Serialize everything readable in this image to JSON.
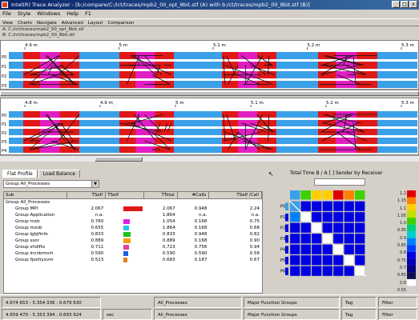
{
  "window": {
    "title": "Intel(R) Trace Analyzer - [b:/compare/C:/ict/traces/mpb2_00_opt_8bit.stf (A) with b:/ct/traces/mpb2_00_8bit.stf (B)]",
    "min": "_",
    "max": "□",
    "close": "x"
  },
  "menu": [
    "File",
    "Style",
    "Windows",
    "Help",
    "F1"
  ],
  "toolbar": [
    "View",
    "Charts",
    "Navigate",
    "Advanced",
    "Layout",
    "Comparison"
  ],
  "files": {
    "a": "A: C:/ict/traces/mpb2_00_opt_8bit.stf",
    "b": "B: C:/ict/traces/mpb2_00_8bit.stf"
  },
  "timeline_top": {
    "ticks": [
      "4.9 m",
      "5 m",
      "5.1 m",
      "5.2 m",
      "5.3 m"
    ],
    "processes": [
      "P0",
      "P1",
      "P2",
      "P3"
    ]
  },
  "timeline_bottom": {
    "ticks": [
      "4.8 m",
      "4.9 m",
      "5 m",
      "5.1 m",
      "5.2 m",
      "5.3 m"
    ],
    "processes": [
      "P0",
      "P1",
      "P2",
      "P3",
      "P4"
    ]
  },
  "profile": {
    "tabs": [
      "Flat Profile",
      "Load Balance"
    ],
    "group_select": "Group All_Processes",
    "columns": [
      "Sub",
      "TSelf",
      "TSelf",
      "TTotal",
      "#Calls",
      "TSelf /Call"
    ],
    "rows": [
      {
        "name": "Group All_Processes",
        "tself": "",
        "ttotal": "",
        "calls": "",
        "per": "",
        "color": "",
        "frac": 0
      },
      {
        "name": "Group MPI",
        "tself": "2.067",
        "ttotal": "2.067",
        "calls": "0.948",
        "per": "2.24",
        "color": "#e01818",
        "frac": 1.0
      },
      {
        "name": "Group Application",
        "tself": "n.a.",
        "ttotal": "1.864",
        "calls": "n.a.",
        "per": "n.a.",
        "color": "",
        "frac": 0
      },
      {
        "name": "Group mxb",
        "tself": "0.760",
        "ttotal": "1.054",
        "calls": "0.168",
        "per": "0.75",
        "color": "#e020e0",
        "frac": 0.33
      },
      {
        "name": "Group mxsb",
        "tself": "0.655",
        "ttotal": "1.864",
        "calls": "0.168",
        "per": "0.68",
        "color": "#20c8e0",
        "frac": 0.28
      },
      {
        "name": "Group lgbjfinfo",
        "tself": "0.833",
        "ttotal": "0.833",
        "calls": "0.948",
        "per": "0.82",
        "color": "#20c020",
        "frac": 0.36
      },
      {
        "name": "Group ssor",
        "tself": "0.889",
        "ttotal": "0.889",
        "calls": "0.168",
        "per": "0.90",
        "color": "#f0a000",
        "frac": 0.38
      },
      {
        "name": "Group shdlfto",
        "tself": "0.711",
        "ttotal": "0.723",
        "calls": "0.756",
        "per": "0.94",
        "color": "#e040a0",
        "frac": 0.31
      },
      {
        "name": "Group incnbrmch",
        "tself": "0.590",
        "ttotal": "0.590",
        "calls": "0.590",
        "per": "0.58",
        "color": "#2060e0",
        "frac": 0.25
      },
      {
        "name": "Group fpoiltyxvm",
        "tself": "0.523",
        "ttotal": "0.683",
        "calls": "0.187",
        "per": "0.67",
        "color": "#e08020",
        "frac": 0.22
      }
    ]
  },
  "matrix": {
    "title": "Total Time B / A [ ] Sender by Receiver",
    "row_labels": [
      "P0",
      "P1",
      "P2",
      "P3",
      "P4",
      "P5",
      "P6"
    ],
    "legend_colors": [
      "#e00000",
      "#ff8000",
      "#ffd000",
      "#c0e000",
      "#40d000",
      "#00d080",
      "#00d0d0",
      "#0080ff",
      "#0040ff",
      "#0000e0",
      "#0000b0",
      "#000080",
      "#101050",
      "#ffffff",
      "#d0d0d0"
    ],
    "legend_labels": [
      "1.2",
      "1.15",
      "1.1",
      "1.05",
      "1.0",
      "0.95",
      "0.9",
      "0.85",
      "0.8",
      "0.75",
      "0.7",
      "0.65",
      "0.6",
      "0.55"
    ]
  },
  "status": {
    "row1": [
      "4.674 653 - 5.354 336 : 0.679 630",
      "All_Processes",
      "Major Function Groups",
      "Tag",
      "Filter"
    ],
    "row2": [
      "4.659 470 - 5.353 394 : 0.693 924",
      "sec",
      "All_Processes",
      "Major Function Groups",
      "Tag",
      "Filter"
    ]
  },
  "colors": {
    "mpi": "#e01818",
    "app": "#3aa0e8",
    "send": "#e020e0",
    "line": "#101010"
  }
}
